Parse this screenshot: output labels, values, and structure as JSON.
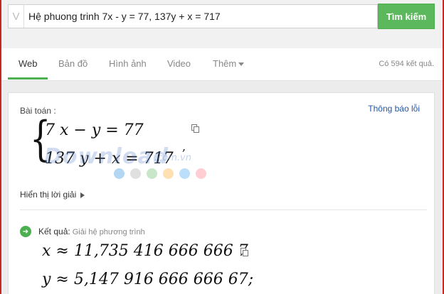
{
  "search": {
    "logo_letter": "V",
    "query": "Hệ phuong trinh 7x - y = 77, 137y + x = 717",
    "button_label": "Tìm kiếm"
  },
  "tabs": [
    {
      "label": "Web",
      "active": true
    },
    {
      "label": "Bản đồ"
    },
    {
      "label": "Hình ảnh"
    },
    {
      "label": "Video"
    },
    {
      "label": "Thêm"
    }
  ],
  "result_count": "Có 594 kết quả.",
  "card": {
    "problem_label": "Bài toán :",
    "report_link": "Thông báo lỗi",
    "equation_1": "7 x − y = 77",
    "equation_2": "137 y + x = 717",
    "show_steps": "Hiển thị lời giải",
    "result_label": "Kết quả:",
    "result_sublabel": "Giải hệ phương trình",
    "answer_1": "x ≈ 11,735 416 666 666 7",
    "answer_2": "y ≈ 5,147 916 666 666 67;"
  },
  "watermark": {
    "main": "Download",
    "suffix": ".com.vn"
  },
  "colors": {
    "accent_green": "#5cb85c",
    "link_blue": "#2155a5",
    "frame_red": "#c62828",
    "dots": [
      "#b3d7f2",
      "#e0e0e0",
      "#c8e6c9",
      "#ffe0b2",
      "#bbdefb",
      "#ffcdd2"
    ]
  }
}
